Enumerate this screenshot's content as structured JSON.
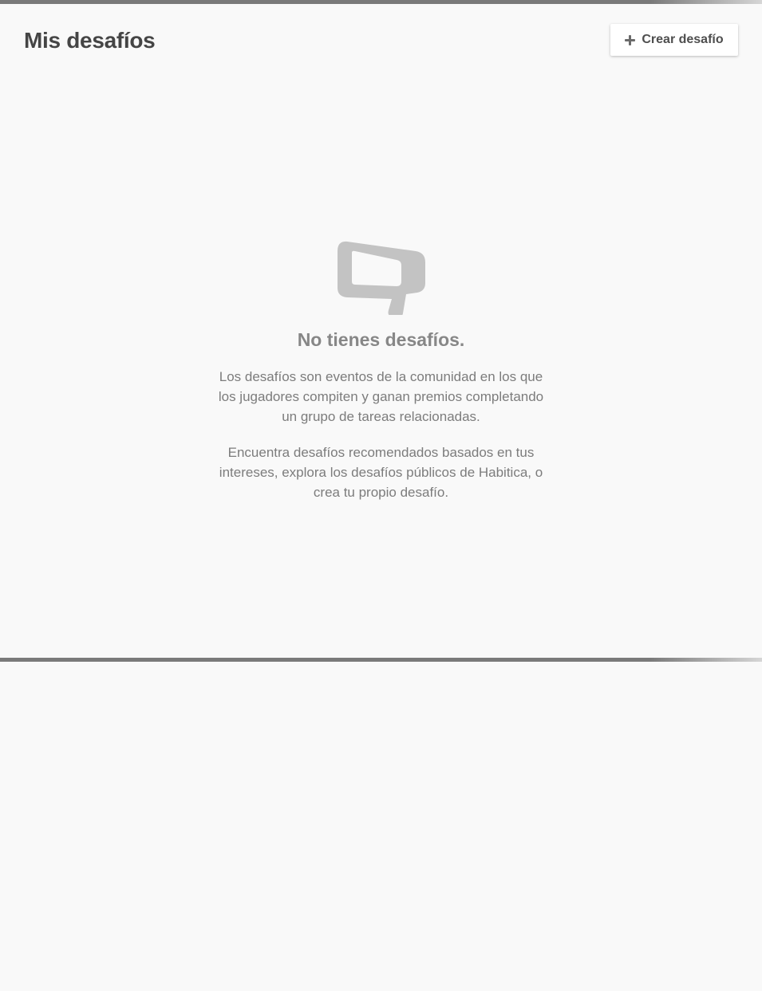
{
  "header": {
    "title": "Mis desafíos",
    "create_button_label": "Crear desafío"
  },
  "empty_state": {
    "icon": "megaphone-icon",
    "title": "No tienes desafíos.",
    "description_1": "Los desafíos son eventos de la comunidad en los que los jugadores compiten y ganan premios completando un grupo de tareas relacionadas.",
    "description_2": "Encuentra desafíos recomendados basados en tus intereses, explora los desafíos públicos de Habitica, o crea tu propio desafío."
  },
  "colors": {
    "background": "#f9f9f9",
    "title_text": "#454545",
    "muted_text": "#878787",
    "icon_gray": "#c3c3c3",
    "rule_gray": "#7a7a7a"
  }
}
